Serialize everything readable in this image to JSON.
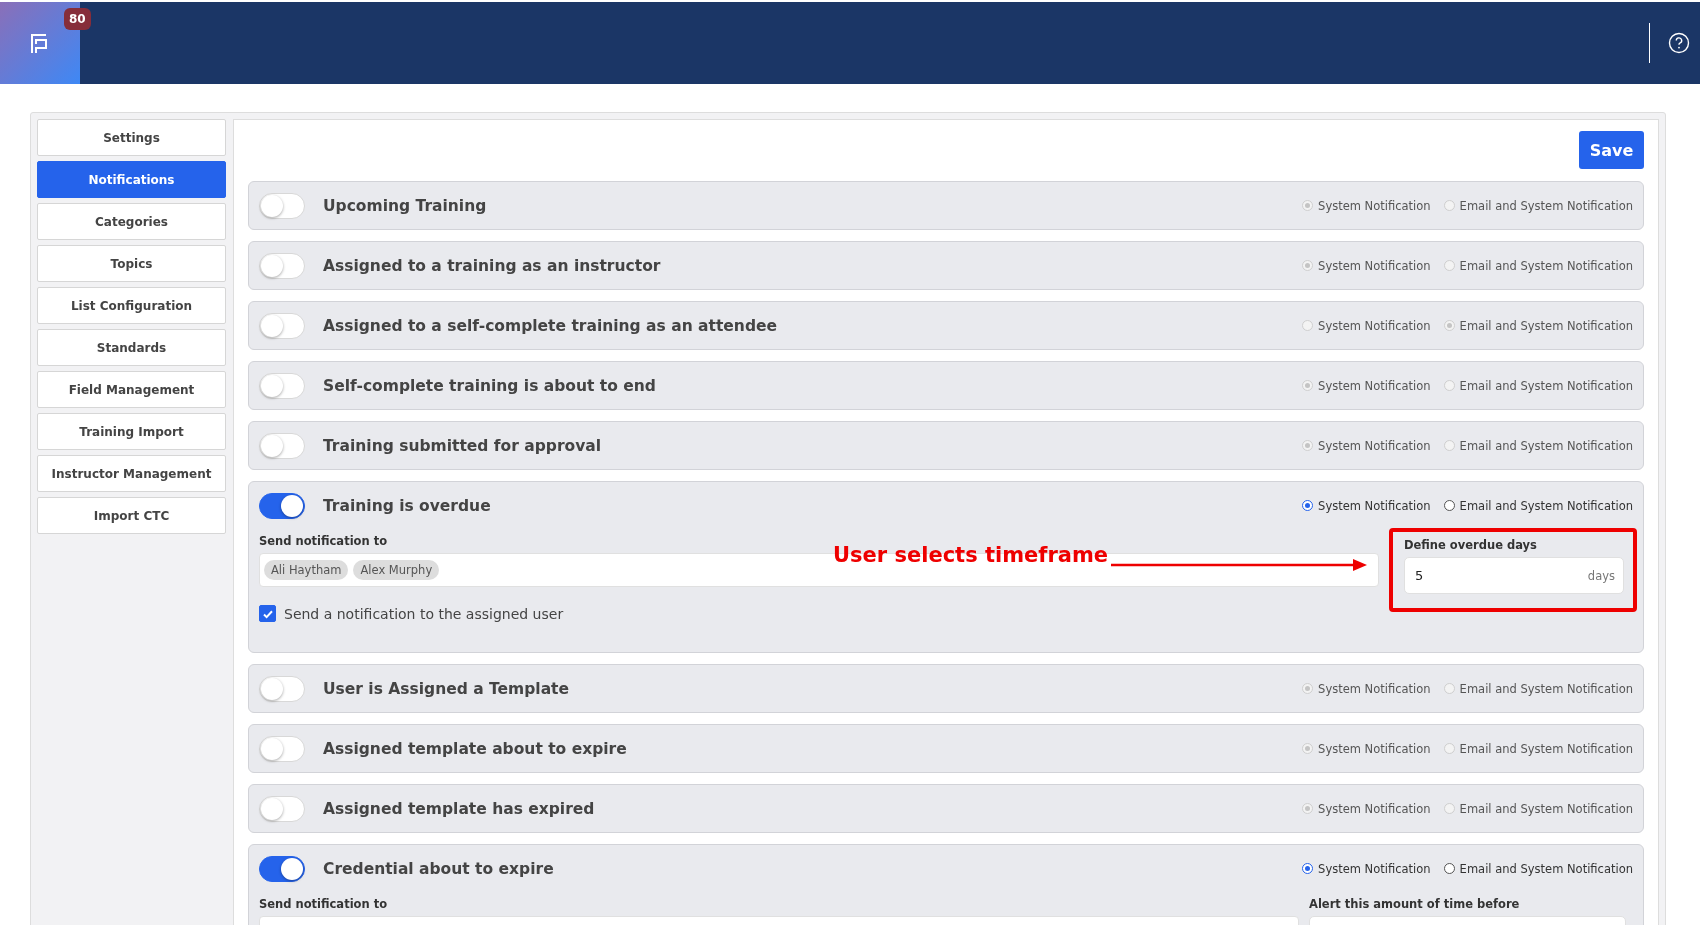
{
  "header": {
    "badge": "80"
  },
  "sidebar": {
    "items": [
      {
        "label": "Settings",
        "selected": false
      },
      {
        "label": "Notifications",
        "selected": true
      },
      {
        "label": "Categories",
        "selected": false
      },
      {
        "label": "Topics",
        "selected": false
      },
      {
        "label": "List Configuration",
        "selected": false
      },
      {
        "label": "Standards",
        "selected": false
      },
      {
        "label": "Field Management",
        "selected": false
      },
      {
        "label": "Training Import",
        "selected": false
      },
      {
        "label": "Instructor Management",
        "selected": false
      },
      {
        "label": "Import CTC",
        "selected": false
      }
    ]
  },
  "save_button": "Save",
  "notifications": [
    {
      "title": "Upcoming Training",
      "on": false,
      "options": [
        {
          "label": "System Notification",
          "selected": true
        },
        {
          "label": "Email and System Notification",
          "selected": false
        }
      ]
    },
    {
      "title": "Assigned to a training as an instructor",
      "on": false,
      "options": [
        {
          "label": "System Notification",
          "selected": true
        },
        {
          "label": "Email and System Notification",
          "selected": false
        }
      ]
    },
    {
      "title": "Assigned to a self-complete training as an attendee",
      "on": false,
      "options": [
        {
          "label": "System Notification",
          "selected": false
        },
        {
          "label": "Email and System Notification",
          "selected": true
        }
      ]
    },
    {
      "title": "Self-complete training is about to end",
      "on": false,
      "options": [
        {
          "label": "System Notification",
          "selected": true
        },
        {
          "label": "Email and System Notification",
          "selected": false
        }
      ]
    },
    {
      "title": "Training submitted for approval",
      "on": false,
      "options": [
        {
          "label": "System Notification",
          "selected": true
        },
        {
          "label": "Email and System Notification",
          "selected": false
        }
      ]
    },
    {
      "title": "Training is overdue",
      "on": true,
      "options": [
        {
          "label": "System Notification",
          "selected": true
        },
        {
          "label": "Email and System Notification",
          "selected": false
        }
      ],
      "details": {
        "recipients_label": "Send notification to",
        "recipients": [
          "Ali Haytham",
          "Alex Murphy"
        ],
        "assigned_user": {
          "label": "Send a notification to the assigned user",
          "checked": true
        },
        "side_field": {
          "kind": "days",
          "label": "Define overdue days",
          "value": "5",
          "unit": "days"
        },
        "annotation": {
          "text": "User selects timeframe"
        }
      }
    },
    {
      "title": "User is Assigned a Template",
      "on": false,
      "options": [
        {
          "label": "System Notification",
          "selected": true
        },
        {
          "label": "Email and System Notification",
          "selected": false
        }
      ]
    },
    {
      "title": "Assigned template about to expire",
      "on": false,
      "options": [
        {
          "label": "System Notification",
          "selected": true
        },
        {
          "label": "Email and System Notification",
          "selected": false
        }
      ]
    },
    {
      "title": "Assigned template has expired",
      "on": false,
      "options": [
        {
          "label": "System Notification",
          "selected": true
        },
        {
          "label": "Email and System Notification",
          "selected": false
        }
      ]
    },
    {
      "title": "Credential about to expire",
      "on": true,
      "options": [
        {
          "label": "System Notification",
          "selected": true
        },
        {
          "label": "Email and System Notification",
          "selected": false
        }
      ],
      "details": {
        "recipients_label": "Send notification to",
        "side_field": {
          "kind": "intervals",
          "label": "Alert this amount of time before"
        }
      }
    }
  ]
}
